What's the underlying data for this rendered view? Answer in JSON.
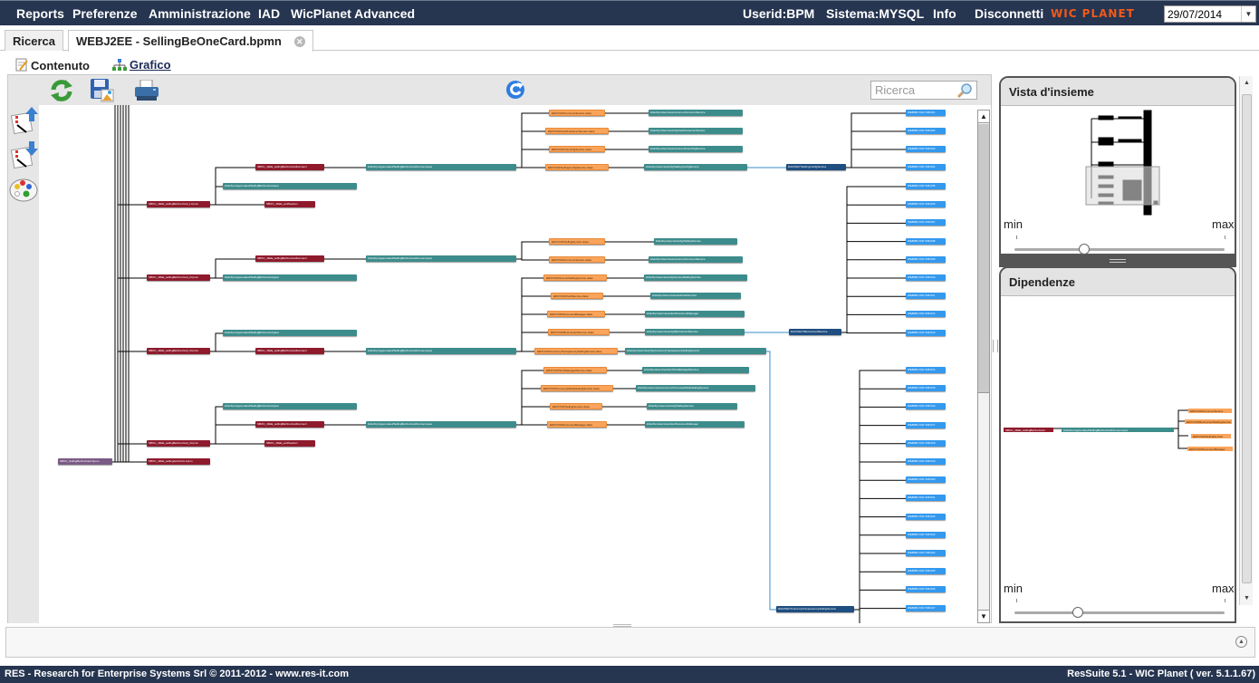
{
  "menu": {
    "items": [
      "Reports",
      "Preferenze",
      "Amministrazione",
      "IAD",
      "WicPlanet Advanced"
    ],
    "userid": "Userid:BPM",
    "sistema": "Sistema:MYSQL",
    "info": "Info",
    "disconnetti": "Disconnetti",
    "logo": "WIC PLANET",
    "date": "29/07/2014"
  },
  "tabs": [
    {
      "label": "Ricerca",
      "active": false
    },
    {
      "label": "WEBJ2EE - SellingBeOneCard.bpmn",
      "active": true,
      "closable": true
    }
  ],
  "subnav": {
    "contenuto": "Contenuto",
    "grafico": "Grafico"
  },
  "toolbar": {
    "icons": [
      "refresh-icon",
      "save-image-icon",
      "print-icon",
      "reload-icon"
    ],
    "search_placeholder": "Ricerca"
  },
  "left_tools": [
    "expand-up-icon",
    "expand-down-icon",
    "palette-icon"
  ],
  "right_panel": {
    "overview": {
      "title": "Vista d'insieme",
      "min": "min",
      "max": "max",
      "zoom_fraction": 0.33
    },
    "dependencies": {
      "title": "Dipendenze",
      "min": "min",
      "max": "max",
      "zoom_fraction": 0.3
    }
  },
  "footer": {
    "left": "RES - Research for Enterprise Systems Srl © 2011-2012 -  www.res-it.com",
    "right": "ResSuite 5.1 - WIC Planet ( ver. 5.1.1.67)"
  },
  "graph": {
    "colors": {
      "process": "#7b5a86",
      "bpmn": "#8e1a2c",
      "java": "#3d8c8c",
      "class": "#f9a45a",
      "db": "#3399ee",
      "dao": "#1f4e80"
    },
    "nodes": [
      {
        "id": "root",
        "type": "purple",
        "label": "SBOC_SellingBeOneCard.bpmn"
      },
      {
        "id": "b1",
        "type": "red",
        "label": "SBOC_J2EE_sellingBeOneCard_1.bpmn"
      },
      {
        "id": "b2",
        "type": "red",
        "label": "SBOC_J2EE_sellingBeOneCard_2.bpmn"
      },
      {
        "id": "b3",
        "type": "red",
        "label": "SBOC_J2EE_sellingBeOneCard_3.bpmn"
      },
      {
        "id": "b4",
        "type": "red",
        "label": "SBOC_J2EE_sellingBeOneCard_4.bpmn"
      },
      {
        "id": "b5",
        "type": "red",
        "label": "SBOC_J2EE_sellingAuthorize.bpmn"
      },
      {
        "id": "c1",
        "type": "red",
        "label": "SBOC_J2EE_sellingBeOneCardConnect"
      },
      {
        "id": "c1b",
        "type": "red",
        "label": "SBOC_J2EE_endSession"
      },
      {
        "id": "c2",
        "type": "red",
        "label": "SBOC_J2EE_sellingBeOneCardConnect"
      },
      {
        "id": "c3",
        "type": "red",
        "label": "SBOC_J2EE_sellingBeOneCardConnect"
      },
      {
        "id": "c4",
        "type": "red",
        "label": "SBOC_J2EE_sellingBeOneCardConnect"
      },
      {
        "id": "c4b",
        "type": "red",
        "label": "SBOC_J2EE_endSession"
      },
      {
        "id": "j1",
        "type": "teal",
        "label": "it/wic/bpm/generated/SellingBeOneCard.java"
      },
      {
        "id": "j2",
        "type": "teal",
        "label": "it/wic/bpm/generated/SellingBeOneCard.java"
      },
      {
        "id": "j3",
        "type": "teal",
        "label": "it/wic/bpm/generated/SellingBeOneCard.java"
      },
      {
        "id": "j4",
        "type": "teal",
        "label": "it/wic/bpm/generated/SellingBeOneCard.java"
      },
      {
        "id": "j5",
        "type": "teal",
        "label": "it/wic/bpm/generated/SellingBeOneCard.java"
      },
      {
        "id": "jc1",
        "type": "teal",
        "label": "it/wic/bpm/generated/SellingBeOneCardConnect.java"
      },
      {
        "id": "jc2",
        "type": "teal",
        "label": "it/wic/bpm/generated/SellingBeOneCardConnect.java"
      },
      {
        "id": "jc3",
        "type": "teal",
        "label": "it/wic/bpm/generated/SellingBeOneCardConnect.java"
      },
      {
        "id": "jc4",
        "type": "teal",
        "label": "it/wic/bpm/generated/SellingBeOneCardConnect.java"
      },
      {
        "id": "k1",
        "type": "orange",
        "label": "EDX/VCD/CommonService.class"
      },
      {
        "id": "k2",
        "type": "orange",
        "label": "EDX/VCD/CardCustomerService.class"
      },
      {
        "id": "k3",
        "type": "orange",
        "label": "EDX/VCD/InsertCfgService.class"
      },
      {
        "id": "k4",
        "type": "orange",
        "label": "EDX/VCD/SellingConfigService.class"
      },
      {
        "id": "k5",
        "type": "orange",
        "label": "EDX/VCD/SellingService.class"
      },
      {
        "id": "k6",
        "type": "orange",
        "label": "EDX/VCD/CommonService.class"
      },
      {
        "id": "k7",
        "type": "orange",
        "label": "EDX/VCD/AccountSellingService.class"
      },
      {
        "id": "k8",
        "type": "orange",
        "label": "EDX/VCD/CardService.class"
      },
      {
        "id": "k9",
        "type": "orange",
        "label": "EDX/VCD/DocumentManager.class"
      },
      {
        "id": "k10",
        "type": "orange",
        "label": "EDX/VCD/BeOneCardService.class"
      },
      {
        "id": "k11",
        "type": "orange",
        "label": "EDX/VCD/CurrencyTransparencySellingService.class"
      },
      {
        "id": "k12",
        "type": "orange",
        "label": "EDX/VCD/SCAManagedService.class"
      },
      {
        "id": "k13",
        "type": "orange",
        "label": "EDX/VCD/CurrencyMobileSellingService.class"
      },
      {
        "id": "k14",
        "type": "orange",
        "label": "EDX/VCD/SellingService.class"
      },
      {
        "id": "k15",
        "type": "orange",
        "label": "EDX/VCD/DocumentManager.class"
      },
      {
        "id": "t1",
        "type": "teal",
        "label": "it/wic/bpm/services/common/CommonService"
      },
      {
        "id": "t2",
        "type": "teal",
        "label": "it/wic/bpm/services/cfg/CardCustomerService"
      },
      {
        "id": "t3",
        "type": "teal",
        "label": "it/wic/bpm/services/common/InsertCfgService"
      },
      {
        "id": "t4",
        "type": "teal",
        "label": "it/wic/bpm/services/cfg/SellingConfigService"
      },
      {
        "id": "t5",
        "type": "teal",
        "label": "it/wic/bpm/services/cfg/SellingService"
      },
      {
        "id": "t6",
        "type": "teal",
        "label": "it/wic/bpm/services/common/CommonService"
      },
      {
        "id": "t7",
        "type": "teal",
        "label": "it/wic/bpm/services/cfg/AccountSellingService"
      },
      {
        "id": "t8",
        "type": "teal",
        "label": "it/wic/bpm/services/card/CardService"
      },
      {
        "id": "t9",
        "type": "teal",
        "label": "it/wic/bpm/services/doc/DocumentManager"
      },
      {
        "id": "t10",
        "type": "teal",
        "label": "it/wic/bpm/services/cfg/BeOneCardService"
      },
      {
        "id": "t11",
        "type": "teal",
        "label": "it/wic/bpm/services/cfg/CurrencyTransparencySellingService"
      },
      {
        "id": "t12",
        "type": "teal",
        "label": "it/wic/bpm/services/doc/SCAManagedService"
      },
      {
        "id": "t13",
        "type": "teal",
        "label": "it/wic/bpm/services/common/CurrencyMobileSellingService"
      },
      {
        "id": "t14",
        "type": "teal",
        "label": "it/wic/bpm/services/cfg/SellingService"
      },
      {
        "id": "t15",
        "type": "teal",
        "label": "it/wic/bpm/services/doc/DocumentManager"
      },
      {
        "id": "d1",
        "type": "navy",
        "label": "DAO/WAY/SellingConfigService"
      },
      {
        "id": "d2",
        "type": "navy",
        "label": "DAO/WAY/BeOneCardService"
      },
      {
        "id": "d3",
        "type": "navy",
        "label": "DAO/WAY/CurrencyTransparencySellingService"
      }
    ],
    "db_tables": [
      "WEBDB.VCD.TAB.001",
      "WEBDB.VCD.TAB.002",
      "WEBDB.VCD.TAB.003",
      "WEBDB.VCD.TAB.004",
      "WEBDB.VCD.TAB.005",
      "WEBDB.VCD.TAB.006",
      "WEBDB.VCD.TAB.007",
      "WEBDB.VCD.TAB.008",
      "WEBDB.VCD.TAB.009",
      "WEBDB.VCD.TAB.010",
      "WEBDB.VCD.TAB.011",
      "WEBDB.VCD.TAB.012",
      "WEBDB.VCD.TAB.013",
      "WEBDB.VCD.TAB.014",
      "WEBDB.VCD.TAB.015",
      "WEBDB.VCD.TAB.016",
      "WEBDB.VCD.TAB.017",
      "WEBDB.VCD.TAB.018",
      "WEBDB.VCD.TAB.019",
      "WEBDB.VCD.TAB.020",
      "WEBDB.VCD.TAB.021",
      "WEBDB.VCD.TAB.022",
      "WEBDB.VCD.TAB.023",
      "WEBDB.VCD.TAB.024",
      "WEBDB.VCD.TAB.025",
      "WEBDB.VCD.TAB.026",
      "WEBDB.VCD.TAB.027",
      "WEBDB.VCD.TAB.028"
    ]
  },
  "dependencies_graph": {
    "nodes": [
      {
        "type": "red",
        "label": "SBOC_J2EE_sellingBeOneCard"
      },
      {
        "type": "teal",
        "label": "it/wic/bpm/generated/SellingBeOneCardConnect.java"
      },
      {
        "type": "orange",
        "label": "EDX/VCD/CommonService"
      },
      {
        "type": "orange",
        "label": "EDX/VCD/BeOneCardSellingService"
      },
      {
        "type": "orange",
        "label": "EDX/VCD/SellingService"
      },
      {
        "type": "orange",
        "label": "EDX/VCD/DocumentManager"
      }
    ]
  }
}
